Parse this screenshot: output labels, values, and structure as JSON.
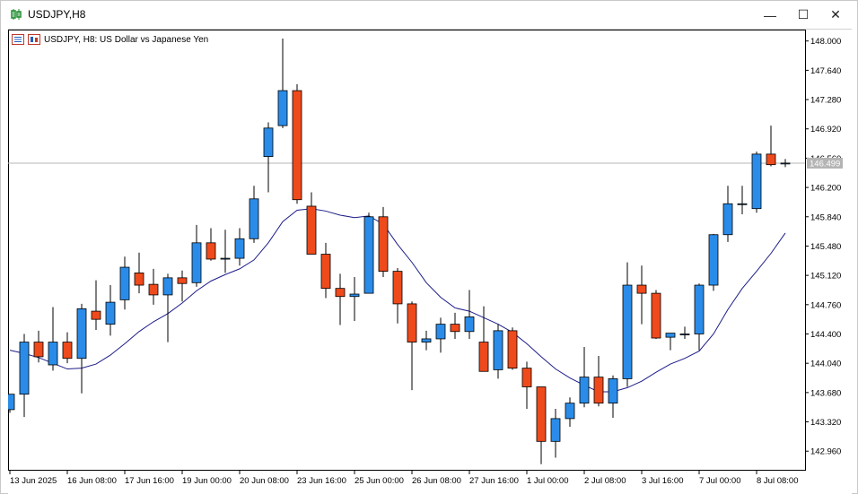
{
  "window": {
    "title": "USDJPY,H8",
    "minimize_glyph": "—",
    "maximize_glyph": "☐",
    "close_glyph": "✕"
  },
  "chart_header": {
    "text": "USDJPY, H8:  US Dollar vs Japanese Yen"
  },
  "colors": {
    "bull": "#2a8ce8",
    "bear": "#ef4a1c",
    "ma": "#1c1c8a",
    "bid_line": "#b4b4b4",
    "price_tag_bg": "#b4b4b4"
  },
  "chart_data": {
    "type": "candlestick",
    "symbol": "USDJPY",
    "timeframe": "H8",
    "ylim": [
      142.72,
      148.14
    ],
    "price_ticks": [
      "148.000",
      "147.640",
      "147.280",
      "146.920",
      "146.560",
      "146.200",
      "145.840",
      "145.480",
      "145.120",
      "144.760",
      "144.400",
      "144.040",
      "143.680",
      "143.320",
      "142.960"
    ],
    "current_price": "146.499",
    "time_labels": [
      {
        "label": "13 Jun 2025",
        "index": 0
      },
      {
        "label": "16 Jun 08:00",
        "index": 4
      },
      {
        "label": "17 Jun 16:00",
        "index": 8
      },
      {
        "label": "19 Jun 00:00",
        "index": 12
      },
      {
        "label": "20 Jun 08:00",
        "index": 16
      },
      {
        "label": "23 Jun 16:00",
        "index": 20
      },
      {
        "label": "25 Jun 00:00",
        "index": 24
      },
      {
        "label": "26 Jun 08:00",
        "index": 28
      },
      {
        "label": "27 Jun 16:00",
        "index": 32
      },
      {
        "label": "1 Jul 00:00",
        "index": 36
      },
      {
        "label": "2 Jul 08:00",
        "index": 40
      },
      {
        "label": "3 Jul 16:00",
        "index": 44
      },
      {
        "label": "7 Jul 00:00",
        "index": 48
      },
      {
        "label": "8 Jul 08:00",
        "index": 52
      }
    ],
    "candles": [
      {
        "o": 143.47,
        "h": 143.55,
        "l": 143.43,
        "c": 143.66
      },
      {
        "o": 143.66,
        "h": 144.4,
        "l": 143.38,
        "c": 144.3
      },
      {
        "o": 144.3,
        "h": 144.44,
        "l": 144.05,
        "c": 144.12
      },
      {
        "o": 144.02,
        "h": 144.73,
        "l": 143.95,
        "c": 144.3
      },
      {
        "o": 144.3,
        "h": 144.42,
        "l": 144.04,
        "c": 144.1
      },
      {
        "o": 144.1,
        "h": 144.77,
        "l": 143.67,
        "c": 144.71
      },
      {
        "o": 144.68,
        "h": 145.06,
        "l": 144.45,
        "c": 144.58
      },
      {
        "o": 144.52,
        "h": 145.0,
        "l": 144.38,
        "c": 144.79
      },
      {
        "o": 144.82,
        "h": 145.35,
        "l": 144.7,
        "c": 145.22
      },
      {
        "o": 145.15,
        "h": 145.4,
        "l": 144.9,
        "c": 145.0
      },
      {
        "o": 145.01,
        "h": 145.2,
        "l": 144.76,
        "c": 144.88
      },
      {
        "o": 144.88,
        "h": 145.14,
        "l": 144.3,
        "c": 145.09
      },
      {
        "o": 145.09,
        "h": 145.18,
        "l": 144.8,
        "c": 145.02
      },
      {
        "o": 145.03,
        "h": 145.74,
        "l": 144.98,
        "c": 145.52
      },
      {
        "o": 145.52,
        "h": 145.7,
        "l": 145.3,
        "c": 145.32
      },
      {
        "o": 145.32,
        "h": 145.68,
        "l": 145.15,
        "c": 145.33
      },
      {
        "o": 145.33,
        "h": 145.7,
        "l": 145.24,
        "c": 145.57
      },
      {
        "o": 145.57,
        "h": 146.22,
        "l": 145.52,
        "c": 146.06
      },
      {
        "o": 146.58,
        "h": 147.0,
        "l": 146.14,
        "c": 146.93
      },
      {
        "o": 146.96,
        "h": 148.03,
        "l": 146.93,
        "c": 147.39
      },
      {
        "o": 147.39,
        "h": 147.47,
        "l": 146.0,
        "c": 146.05
      },
      {
        "o": 145.97,
        "h": 146.14,
        "l": 145.38,
        "c": 145.38
      },
      {
        "o": 145.38,
        "h": 145.52,
        "l": 144.84,
        "c": 144.96
      },
      {
        "o": 144.96,
        "h": 145.14,
        "l": 144.51,
        "c": 144.86
      },
      {
        "o": 144.86,
        "h": 145.1,
        "l": 144.56,
        "c": 144.89
      },
      {
        "o": 144.9,
        "h": 145.89,
        "l": 144.9,
        "c": 145.84
      },
      {
        "o": 145.84,
        "h": 145.96,
        "l": 145.1,
        "c": 145.17
      },
      {
        "o": 145.17,
        "h": 145.21,
        "l": 144.53,
        "c": 144.77
      },
      {
        "o": 144.77,
        "h": 144.8,
        "l": 143.71,
        "c": 144.3
      },
      {
        "o": 144.3,
        "h": 144.44,
        "l": 144.2,
        "c": 144.34
      },
      {
        "o": 144.34,
        "h": 144.6,
        "l": 144.17,
        "c": 144.52
      },
      {
        "o": 144.52,
        "h": 144.66,
        "l": 144.34,
        "c": 144.43
      },
      {
        "o": 144.43,
        "h": 144.94,
        "l": 144.34,
        "c": 144.61
      },
      {
        "o": 144.3,
        "h": 144.74,
        "l": 143.96,
        "c": 143.94
      },
      {
        "o": 143.96,
        "h": 144.52,
        "l": 143.85,
        "c": 144.44
      },
      {
        "o": 144.44,
        "h": 144.48,
        "l": 143.96,
        "c": 143.98
      },
      {
        "o": 143.98,
        "h": 144.06,
        "l": 143.48,
        "c": 143.75
      },
      {
        "o": 143.75,
        "h": 143.75,
        "l": 142.8,
        "c": 143.08
      },
      {
        "o": 143.08,
        "h": 143.48,
        "l": 142.88,
        "c": 143.36
      },
      {
        "o": 143.36,
        "h": 143.62,
        "l": 143.26,
        "c": 143.55
      },
      {
        "o": 143.55,
        "h": 144.24,
        "l": 143.5,
        "c": 143.87
      },
      {
        "o": 143.87,
        "h": 144.13,
        "l": 143.51,
        "c": 143.55
      },
      {
        "o": 143.55,
        "h": 143.89,
        "l": 143.37,
        "c": 143.85
      },
      {
        "o": 143.85,
        "h": 145.28,
        "l": 143.75,
        "c": 145.0
      },
      {
        "o": 145.0,
        "h": 145.24,
        "l": 144.52,
        "c": 144.9
      },
      {
        "o": 144.9,
        "h": 144.94,
        "l": 144.34,
        "c": 144.35
      },
      {
        "o": 144.36,
        "h": 144.41,
        "l": 144.2,
        "c": 144.41
      },
      {
        "o": 144.4,
        "h": 144.49,
        "l": 144.34,
        "c": 144.4
      },
      {
        "o": 144.4,
        "h": 145.02,
        "l": 144.2,
        "c": 145.0
      },
      {
        "o": 145.0,
        "h": 145.63,
        "l": 144.93,
        "c": 145.62
      },
      {
        "o": 145.62,
        "h": 146.22,
        "l": 145.53,
        "c": 146.0
      },
      {
        "o": 146.0,
        "h": 146.22,
        "l": 145.87,
        "c": 146.0
      },
      {
        "o": 145.94,
        "h": 146.64,
        "l": 145.89,
        "c": 146.61
      },
      {
        "o": 146.61,
        "h": 146.96,
        "l": 146.46,
        "c": 146.48
      },
      {
        "o": 146.49,
        "h": 146.55,
        "l": 146.45,
        "c": 146.5
      }
    ],
    "ma": [
      144.2,
      144.16,
      144.11,
      144.04,
      143.97,
      143.98,
      144.03,
      144.14,
      144.28,
      144.43,
      144.55,
      144.65,
      144.78,
      144.93,
      145.05,
      145.13,
      145.2,
      145.31,
      145.52,
      145.78,
      145.92,
      145.94,
      145.91,
      145.86,
      145.83,
      145.85,
      145.75,
      145.5,
      145.28,
      145.03,
      144.85,
      144.72,
      144.68,
      144.6,
      144.52,
      144.42,
      144.28,
      144.12,
      143.97,
      143.86,
      143.77,
      143.69,
      143.69,
      143.74,
      143.82,
      143.93,
      144.03,
      144.1,
      144.19,
      144.4,
      144.7,
      144.96,
      145.17,
      145.39,
      145.64
    ]
  }
}
